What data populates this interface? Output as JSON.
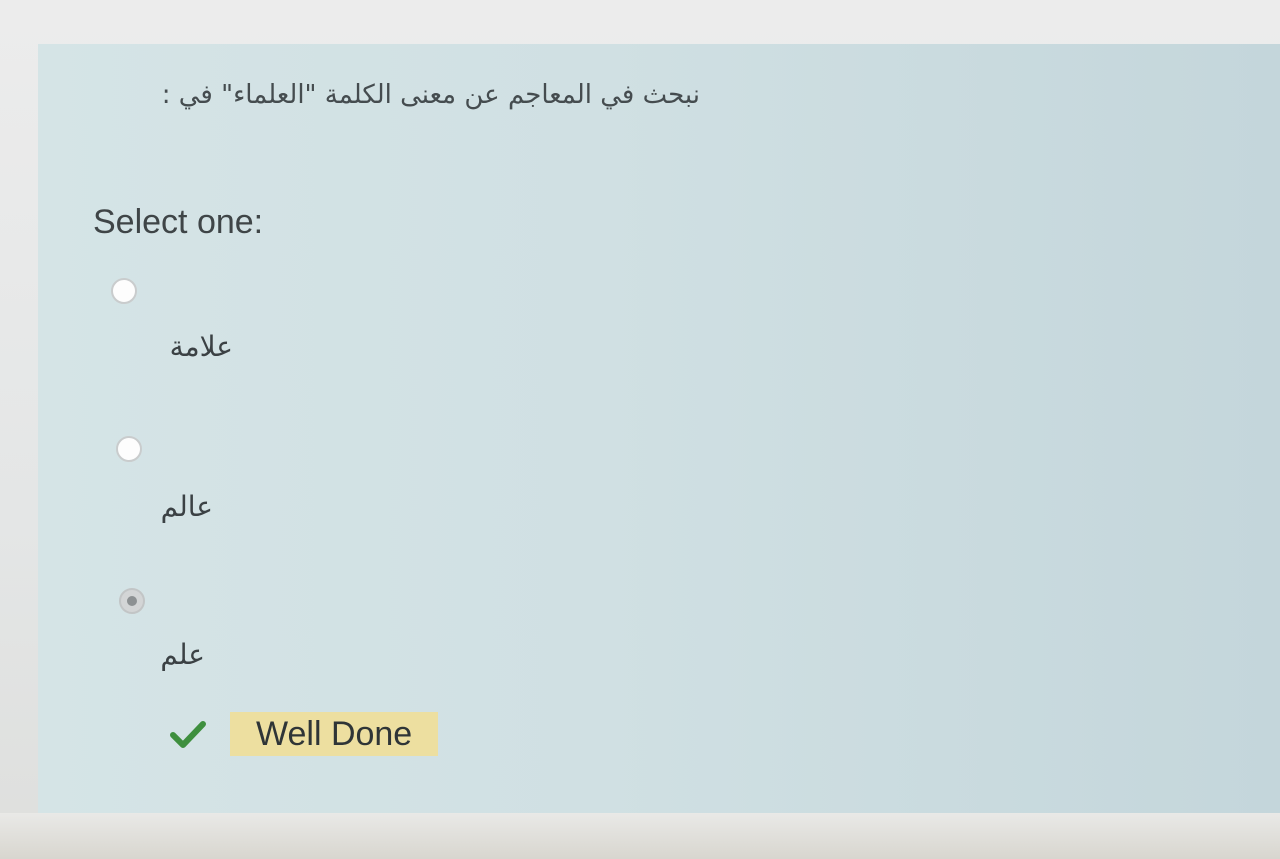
{
  "question": {
    "text": "نبحث في المعاجم عن معنى الكلمة \"العلماء\" في :",
    "prompt": "Select one:"
  },
  "options": [
    {
      "label": "علامة",
      "selected": false
    },
    {
      "label": "عالم",
      "selected": false
    },
    {
      "label": "علم",
      "selected": true
    }
  ],
  "feedback": {
    "icon": "checkmark-icon",
    "text": "Well Done",
    "icon_color": "#3e8f3e",
    "highlight_color": "#eddfa0"
  }
}
